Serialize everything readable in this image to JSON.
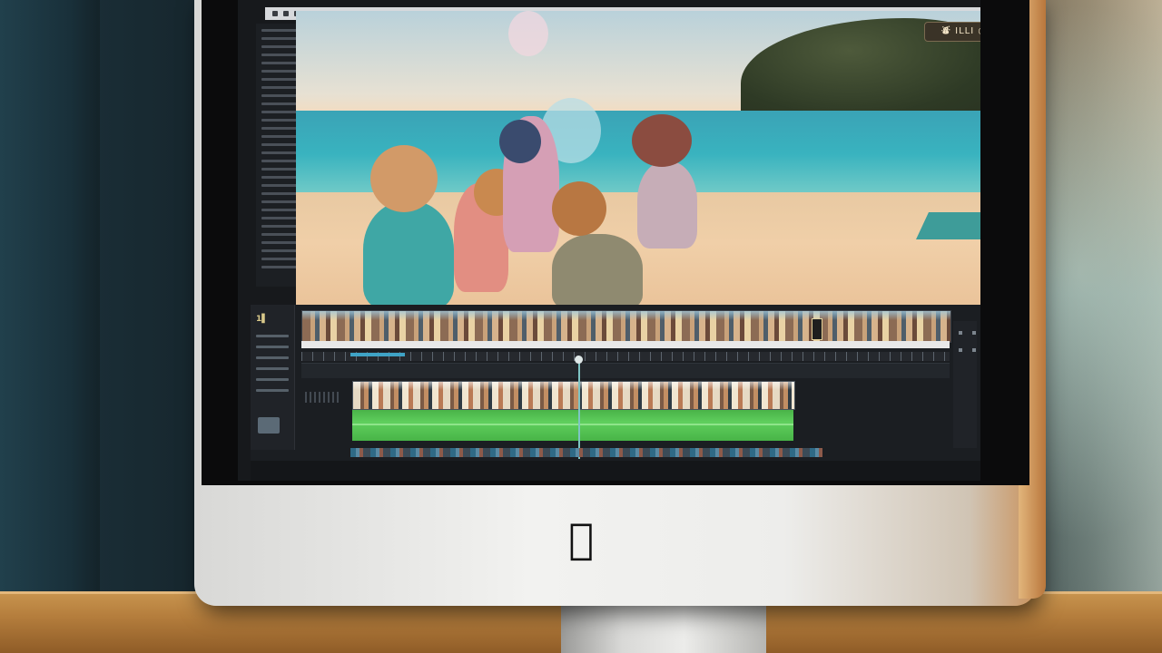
{
  "app": {
    "name": "video editor",
    "menubar_items": 8
  },
  "viewer": {
    "badge_text": "⛇ ILLI ◎",
    "corner_icon": "▣"
  },
  "timeline": {
    "timecode": "1▌",
    "tracks": [
      "video-track",
      "audio-track"
    ]
  },
  "hardware": {
    "logo": ""
  },
  "colors": {
    "audio_clip": "#5fcf5d",
    "playhead": "#7ec4c4",
    "selection": "#3fa3c6",
    "ui_dark": "#1b1e22"
  }
}
